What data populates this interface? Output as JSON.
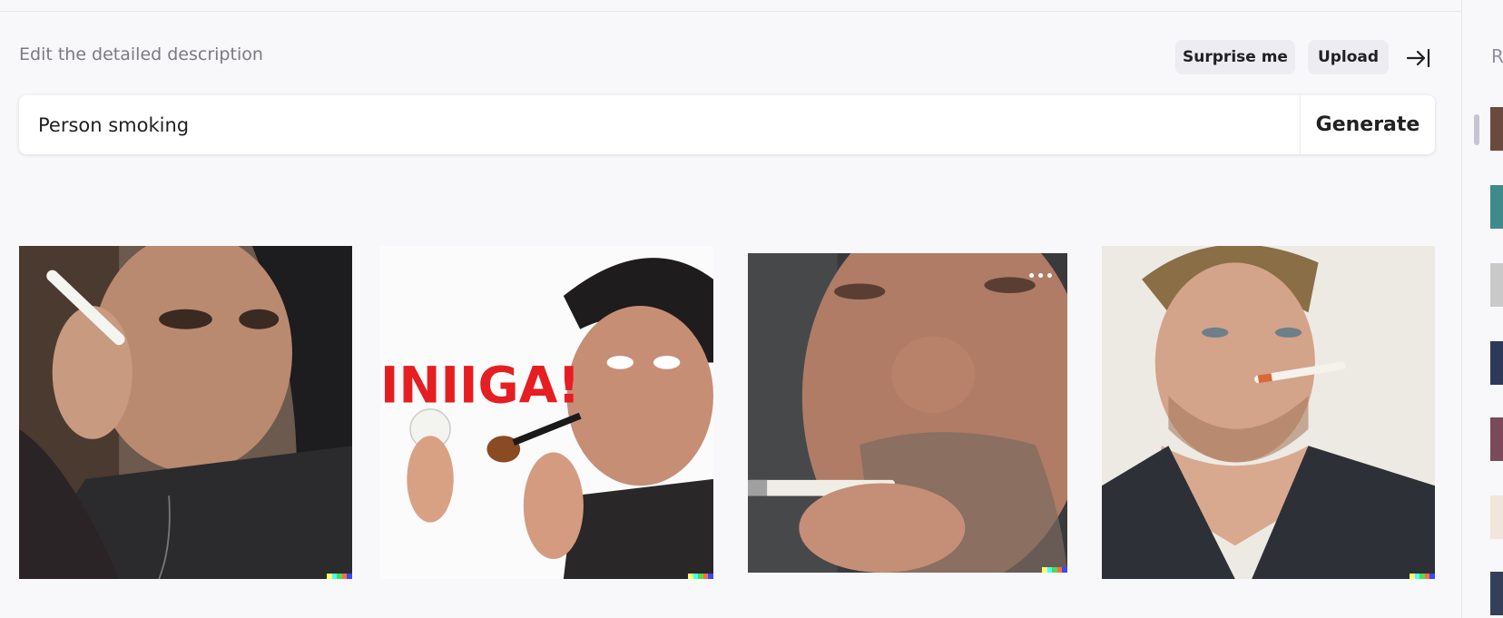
{
  "editor": {
    "hint": "Edit the detailed description",
    "surprise_label": "Surprise me",
    "upload_label": "Upload",
    "collapse_icon": "arrow-right-to-bar-icon",
    "prompt_value": "Person smoking",
    "generate_label": "Generate"
  },
  "results": [
    {
      "subject": "woman-holding-cigarette"
    },
    {
      "subject": "man-with-pipe-and-lightbulb",
      "sign_text": "INIIGA!"
    },
    {
      "subject": "closeup-man-cigarette"
    },
    {
      "subject": "man-cigarette-in-mouth"
    }
  ],
  "badge_colors": [
    "#ffff66",
    "#42ffff",
    "#51da4c",
    "#ff6e3c",
    "#3c46ff"
  ],
  "history_panel": {
    "heading_initial": "R",
    "thumbnail_count": 7
  }
}
